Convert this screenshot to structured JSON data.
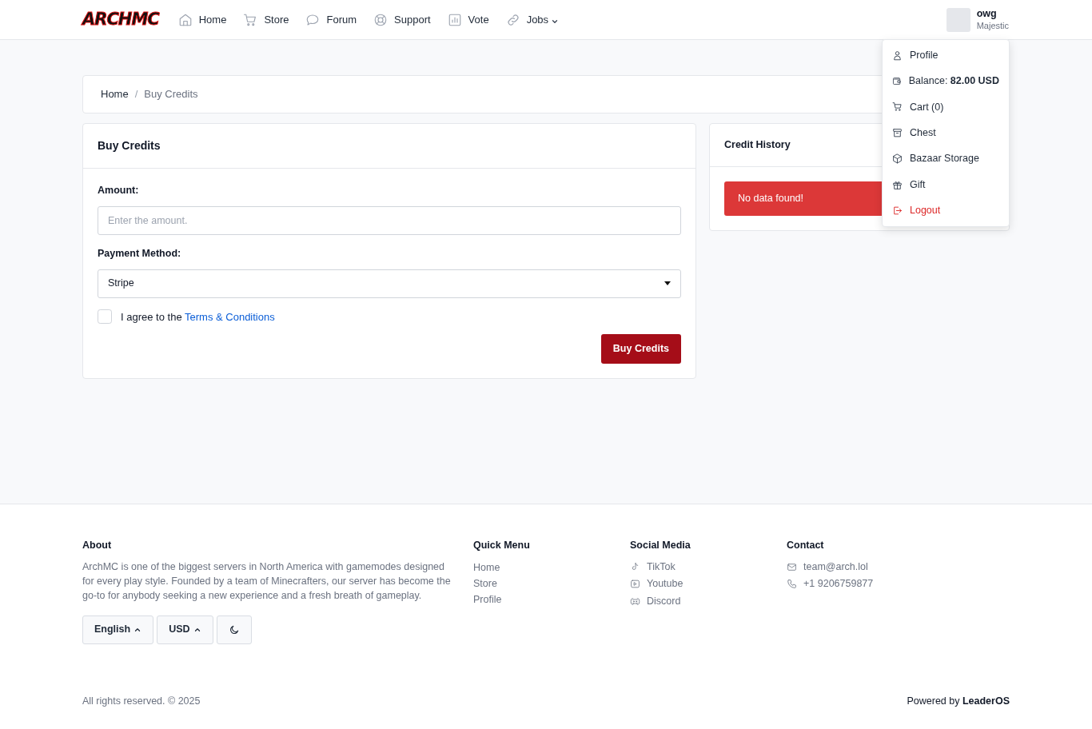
{
  "navbar": {
    "logo": "ARCHMC",
    "items": [
      {
        "label": "Home",
        "kind": "home",
        "dropdown": false
      },
      {
        "label": "Store",
        "kind": "cart",
        "dropdown": false
      },
      {
        "label": "Forum",
        "kind": "chat",
        "dropdown": false
      },
      {
        "label": "Support",
        "kind": "lifebuoy",
        "dropdown": false
      },
      {
        "label": "Vote",
        "kind": "chart",
        "dropdown": false
      },
      {
        "label": "Jobs",
        "kind": "link",
        "dropdown": true
      }
    ],
    "user": {
      "name": "owg",
      "rank": "Majestic"
    },
    "user_menu": [
      {
        "label": "Profile",
        "kind": "user"
      },
      {
        "label": "Balance: **82.00 USD**",
        "kind": "wallet"
      },
      {
        "label": "Cart (0)",
        "kind": "cart"
      },
      {
        "label": "Chest",
        "kind": "archive"
      },
      {
        "label": "Bazaar Storage",
        "kind": "cube"
      },
      {
        "label": "Gift",
        "kind": "gift"
      },
      {
        "label": "Logout",
        "kind": "logout"
      }
    ]
  },
  "breadcrumb": {
    "separator": "/",
    "items": [
      {
        "label": "Home",
        "active": false
      },
      {
        "label": "Buy Credits",
        "active": true
      }
    ]
  },
  "buy_card": {
    "title": "Buy Credits",
    "amount_label": "Amount:",
    "amount_placeholder": "Enter the amount.",
    "payment_label": "Payment Method:",
    "payment_value": "Stripe",
    "agree_text": "I agree to the",
    "agree_link": "Terms & Conditions",
    "agree_checked": false,
    "button": "Buy Credits"
  },
  "history_card": {
    "title": "Credit History",
    "alert": "No data found!"
  },
  "footer": {
    "about_title": "About",
    "about_text": "ArchMC is one of the biggest servers in North America with gamemodes designed for every play style. Founded by a team of Minecrafters, our server has become the go-to for anybody seeking a new experience and a fresh breath of gameplay.",
    "language": "English",
    "currency": "USD",
    "quick_title": "Quick Menu",
    "quick_links": [
      "Home",
      "Store",
      "Profile"
    ],
    "social_title": "Social Media",
    "social_links": [
      {
        "label": "TikTok",
        "kind": "tiktok"
      },
      {
        "label": "Youtube",
        "kind": "youtube"
      },
      {
        "label": "Discord",
        "kind": "discord"
      }
    ],
    "contact_title": "Contact",
    "contacts": [
      {
        "label": "team@arch.lol",
        "kind": "mail"
      },
      {
        "label": "+1 9206759877",
        "kind": "phone"
      }
    ],
    "copyright": "All rights reserved. © 2025",
    "powered_text": "Powered by",
    "powered_brand": "LeaderOS"
  }
}
